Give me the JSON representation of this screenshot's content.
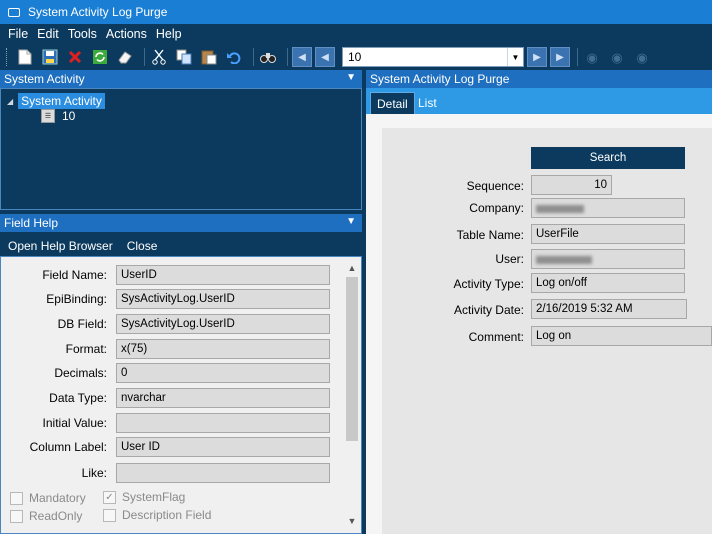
{
  "window": {
    "title": "System Activity Log Purge"
  },
  "menu": [
    "File",
    "Edit",
    "Tools",
    "Actions",
    "Help"
  ],
  "toolbar": {
    "icons": [
      "new-icon",
      "save-icon",
      "delete-icon",
      "refresh-icon",
      "clear-icon",
      "cut-icon",
      "copy-icon",
      "paste-icon",
      "undo-icon",
      "binoculars-icon"
    ],
    "record_combo": "10"
  },
  "tree_panel": {
    "title": "System Activity",
    "root": "System Activity",
    "child": "10"
  },
  "field_help": {
    "title": "Field Help",
    "actions": {
      "open_browser": "Open Help Browser",
      "close": "Close"
    },
    "rows": [
      {
        "label": "Field Name:",
        "value": "UserID"
      },
      {
        "label": "EpiBinding:",
        "value": "SysActivityLog.UserID"
      },
      {
        "label": "DB Field:",
        "value": "SysActivityLog.UserID"
      },
      {
        "label": "Format:",
        "value": "x(75)"
      },
      {
        "label": "Decimals:",
        "value": "0"
      },
      {
        "label": "Data Type:",
        "value": "nvarchar"
      },
      {
        "label": "Initial Value:",
        "value": ""
      },
      {
        "label": "Column Label:",
        "value": "User ID"
      },
      {
        "label": "Like:",
        "value": ""
      }
    ],
    "checkboxes": [
      {
        "label": "Mandatory",
        "checked": false
      },
      {
        "label": "SystemFlag",
        "checked": true
      },
      {
        "label": "ReadOnly",
        "checked": false
      },
      {
        "label": "Description Field",
        "checked": false
      }
    ]
  },
  "main_panel": {
    "title": "System Activity Log Purge",
    "tabs": [
      "Detail",
      "List"
    ],
    "search_label": "Search",
    "fields": {
      "sequence": {
        "label": "Sequence:",
        "value": "10"
      },
      "company": {
        "label": "Company:",
        "value": ""
      },
      "table_name": {
        "label": "Table Name:",
        "value": "UserFile"
      },
      "user": {
        "label": "User:",
        "value": ""
      },
      "activity_type": {
        "label": "Activity Type:",
        "value": "Log on/off"
      },
      "activity_date": {
        "label": "Activity Date:",
        "value": "2/16/2019 5:32 AM"
      },
      "comment": {
        "label": "Comment:",
        "value": "Log on"
      }
    }
  }
}
